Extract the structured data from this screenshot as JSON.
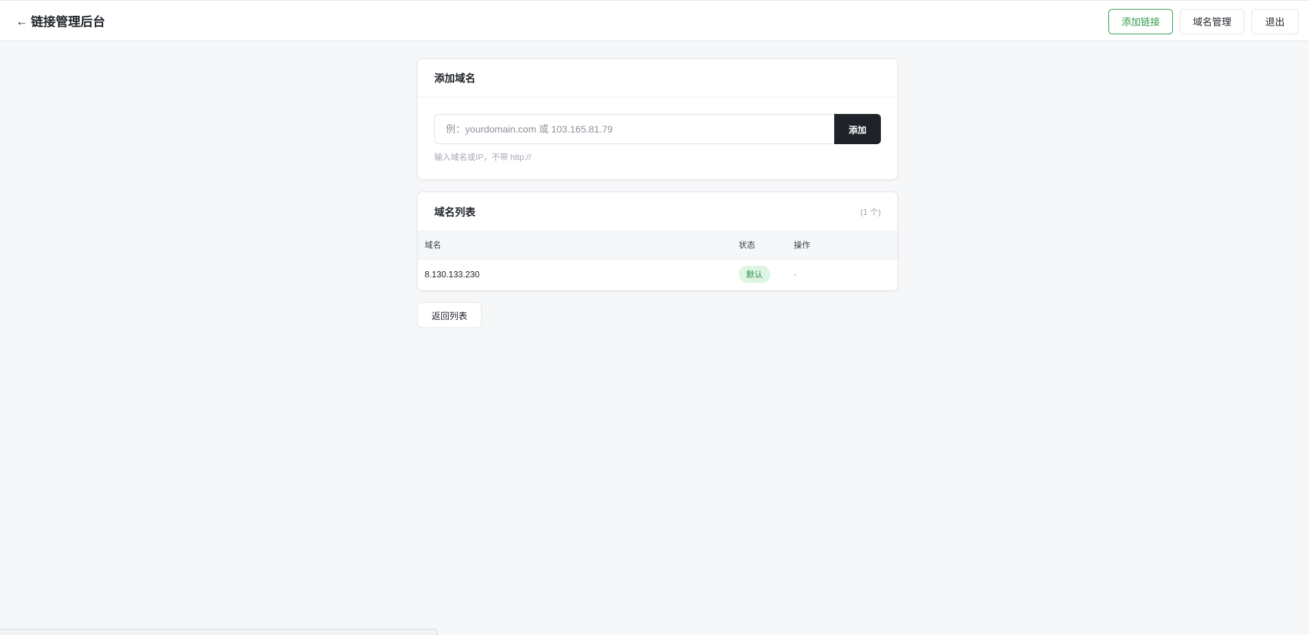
{
  "header": {
    "back_arrow": "←",
    "title": "链接管理后台",
    "add_link_label": "添加链接",
    "domain_manage_label": "域名管理",
    "logout_label": "退出",
    "accent_color": "#2e9a4a"
  },
  "add_domain": {
    "title": "添加域名",
    "input_value": "",
    "input_placeholder": "例：yourdomain.com 或 103.165.81.79",
    "add_button_label": "添加",
    "hint": "输入域名或IP，不带 http://"
  },
  "domain_list": {
    "title": "域名列表",
    "count": "(1 个)",
    "columns": [
      "域名",
      "状态",
      "操作"
    ],
    "rows": [
      {
        "domain": "8.130.133.230",
        "status": "默认",
        "action": "-"
      }
    ]
  },
  "back_to_list_label": "返回列表"
}
